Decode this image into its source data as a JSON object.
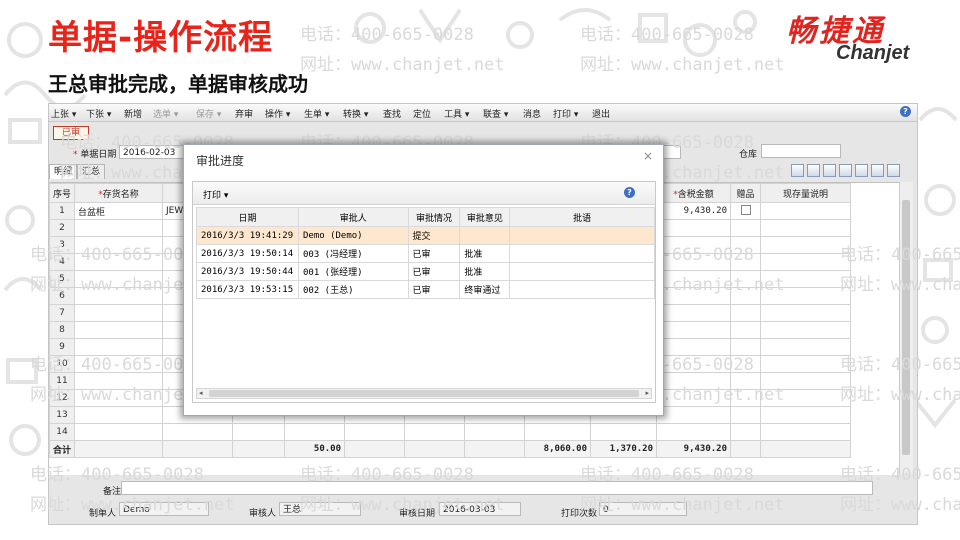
{
  "slide": {
    "title": "单据-操作流程",
    "subtitle": "王总审批完成，单据审核成功",
    "brand_cn": "畅捷通",
    "brand_en": "Chanjet",
    "brand_color": "#e02520",
    "watermark_phone": "电话：400-665-0028",
    "watermark_url": "网址：www.chanjet.net"
  },
  "app": {
    "menu": [
      {
        "label": "上张 ▾",
        "disabled": false
      },
      {
        "label": "下张 ▾",
        "disabled": false
      },
      {
        "label": "新增",
        "disabled": false
      },
      {
        "label": "选单 ▾",
        "disabled": true
      },
      {
        "label": "保存 ▾",
        "disabled": true
      },
      {
        "label": "弃审",
        "disabled": false
      },
      {
        "label": "操作 ▾",
        "disabled": false
      },
      {
        "label": "生单 ▾",
        "disabled": false
      },
      {
        "label": "转换 ▾",
        "disabled": false
      },
      {
        "label": "查找",
        "disabled": false
      },
      {
        "label": "定位",
        "disabled": false
      },
      {
        "label": "工具 ▾",
        "disabled": false
      },
      {
        "label": "联查 ▾",
        "disabled": false
      },
      {
        "label": "消息",
        "disabled": false
      },
      {
        "label": "打印 ▾",
        "disabled": false
      },
      {
        "label": "退出",
        "disabled": false
      }
    ],
    "help_glyph": "?",
    "status_stamp": "已审",
    "doc_date_label": "单据日期",
    "doc_date_value": "2016-02-03",
    "warehouse_label": "仓库",
    "tabs": [
      "明细",
      "汇总"
    ],
    "grid": {
      "headers": [
        "序号",
        "存货名称",
        "",
        "",
        "",
        "",
        "",
        "",
        "",
        "",
        "含税金额",
        "赠品",
        "现存量说明"
      ],
      "required_cols": [
        1,
        10
      ],
      "rows": [
        [
          "1",
          "台盆柜",
          "JEW-",
          "",
          "",
          "",
          "",
          "",
          "",
          "",
          "9,430.20",
          "",
          ""
        ],
        [
          "2",
          "",
          "",
          "",
          "",
          "",
          "",
          "",
          "",
          "",
          "",
          "",
          ""
        ],
        [
          "3",
          "",
          "",
          "",
          "",
          "",
          "",
          "",
          "",
          "",
          "",
          "",
          ""
        ],
        [
          "4",
          "",
          "",
          "",
          "",
          "",
          "",
          "",
          "",
          "",
          "",
          "",
          ""
        ],
        [
          "5",
          "",
          "",
          "",
          "",
          "",
          "",
          "",
          "",
          "",
          "",
          "",
          ""
        ],
        [
          "6",
          "",
          "",
          "",
          "",
          "",
          "",
          "",
          "",
          "",
          "",
          "",
          ""
        ],
        [
          "7",
          "",
          "",
          "",
          "",
          "",
          "",
          "",
          "",
          "",
          "",
          "",
          ""
        ],
        [
          "8",
          "",
          "",
          "",
          "",
          "",
          "",
          "",
          "",
          "",
          "",
          "",
          ""
        ],
        [
          "9",
          "",
          "",
          "",
          "",
          "",
          "",
          "",
          "",
          "",
          "",
          "",
          ""
        ],
        [
          "10",
          "",
          "",
          "",
          "",
          "",
          "",
          "",
          "",
          "",
          "",
          "",
          ""
        ],
        [
          "11",
          "",
          "",
          "",
          "",
          "",
          "",
          "",
          "",
          "",
          "",
          "",
          ""
        ],
        [
          "12",
          "",
          "",
          "",
          "",
          "",
          "",
          "",
          "",
          "",
          "",
          "",
          ""
        ],
        [
          "13",
          "",
          "",
          "",
          "",
          "",
          "",
          "",
          "",
          "",
          "",
          "",
          ""
        ],
        [
          "14",
          "",
          "",
          "",
          "",
          "",
          "",
          "",
          "",
          "",
          "",
          "",
          ""
        ]
      ],
      "total_row": [
        "合计",
        "",
        "",
        "",
        "50.00",
        "",
        "",
        "",
        "8,060.00",
        "1,370.20",
        "9,430.20",
        "",
        ""
      ]
    },
    "footer": {
      "remark_label": "备注",
      "maker_label": "制单人",
      "maker_value": "Demo",
      "auditor_label": "审核人",
      "auditor_value": "王总",
      "audit_date_label": "审核日期",
      "audit_date_value": "2016-03-03",
      "print_count_label": "打印次数",
      "print_count_value": "0"
    }
  },
  "dialog": {
    "title": "审批进度",
    "close_glyph": "×",
    "print_label": "打印 ▾",
    "help_glyph": "?",
    "headers": [
      "日期",
      "审批人",
      "审批情况",
      "审批意见",
      "批语"
    ],
    "rows": [
      [
        "2016/3/3 19:41:29",
        "Demo (Demo)",
        "提交",
        "",
        ""
      ],
      [
        "2016/3/3 19:50:14",
        "003 (冯经理)",
        "已审",
        "批准",
        ""
      ],
      [
        "2016/3/3 19:50:44",
        "001 (张经理)",
        "已审",
        "批准",
        ""
      ],
      [
        "2016/3/3 19:53:15",
        "002 (王总)",
        "已审",
        "终审通过",
        ""
      ]
    ],
    "scroll_left": "◂",
    "scroll_right": "▸"
  }
}
